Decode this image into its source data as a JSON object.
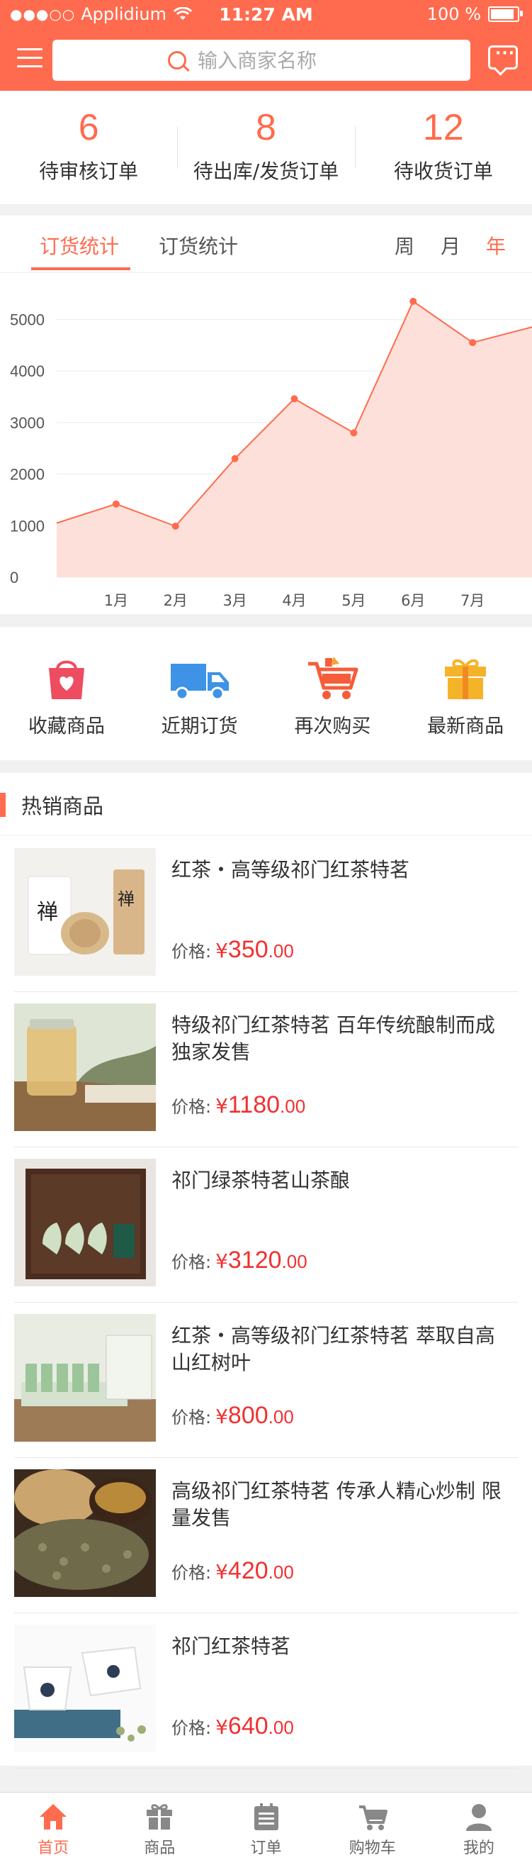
{
  "status_bar": {
    "carrier": "Applidium",
    "time": "11:27 AM",
    "battery": "100 %",
    "battery_level": 1.0
  },
  "header": {
    "search_placeholder": "输入商家名称"
  },
  "order_stats": [
    {
      "count": "6",
      "label": "待审核订单"
    },
    {
      "count": "8",
      "label": "待出库/发货订单"
    },
    {
      "count": "12",
      "label": "待收货订单"
    }
  ],
  "chart_section": {
    "tabs": [
      "订货统计",
      "订货统计"
    ],
    "periods": [
      "周",
      "月",
      "年"
    ],
    "active_period": "年"
  },
  "chart_data": {
    "type": "area",
    "categories": [
      "1月",
      "2月",
      "3月",
      "4月",
      "5月",
      "6月",
      "7月"
    ],
    "x": [
      0,
      1,
      2,
      3,
      4,
      5,
      6,
      7,
      8
    ],
    "values": [
      1050,
      1420,
      990,
      2300,
      3460,
      2800,
      5350,
      4550,
      4850
    ],
    "yticks": [
      0,
      1000,
      2000,
      3000,
      4000,
      5000
    ],
    "ylim": [
      0,
      5500
    ],
    "grid": true,
    "colors": {
      "line": "#ff6b4e",
      "fill": "#fde0da",
      "point": "#ff6b4e"
    }
  },
  "quick_actions": [
    {
      "label": "收藏商品",
      "icon": "shopping-bag-heart-icon",
      "color": "#ee4c60"
    },
    {
      "label": "近期订货",
      "icon": "delivery-truck-icon",
      "color": "#3e93e6"
    },
    {
      "label": "再次购买",
      "icon": "shopping-cart-icon",
      "color": "#f55d3a"
    },
    {
      "label": "最新商品",
      "icon": "gift-box-icon",
      "color": "#f5b329"
    }
  ],
  "hot_products": {
    "title": "热销商品",
    "price_label": "价格:",
    "currency": "¥",
    "items": [
      {
        "name": "红茶・高等级祁门红茶特茗",
        "price_int": "350",
        "price_dec": ".00",
        "thumb": "tea-canisters"
      },
      {
        "name": "特级祁门红茶特茗 百年传统酿制而成 独家发售",
        "price_int": "1180",
        "price_dec": ".00",
        "thumb": "honey-jar"
      },
      {
        "name": "祁门绿茶特茗山茶酿",
        "price_int": "3120",
        "price_dec": ".00",
        "thumb": "gift-box-leaves"
      },
      {
        "name": "红茶・高等级祁门红茶特茗 萃取自高山红树叶",
        "price_int": "800",
        "price_dec": ".00",
        "thumb": "green-packaging"
      },
      {
        "name": "高级祁门红茶特茗 传承人精心炒制 限量发售",
        "price_int": "420",
        "price_dec": ".00",
        "thumb": "tea-cups-leaves"
      },
      {
        "name": "祁门红茶特茗",
        "price_int": "640",
        "price_dec": ".00",
        "thumb": "white-cups"
      }
    ]
  },
  "tab_bar": [
    {
      "label": "首页",
      "icon": "home-icon",
      "active": true
    },
    {
      "label": "商品",
      "icon": "gift-icon",
      "active": false
    },
    {
      "label": "订单",
      "icon": "clipboard-icon",
      "active": false
    },
    {
      "label": "购物车",
      "icon": "cart-icon",
      "active": false
    },
    {
      "label": "我的",
      "icon": "user-icon",
      "active": false
    }
  ]
}
